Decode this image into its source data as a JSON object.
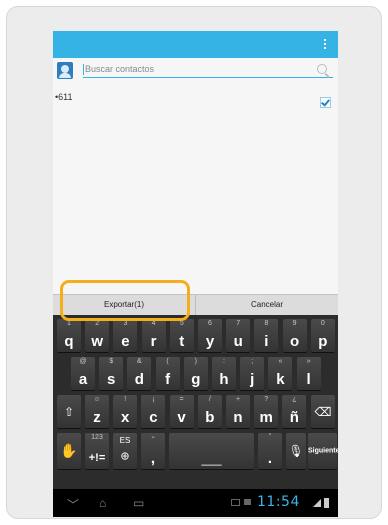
{
  "search": {
    "placeholder": "Buscar contactos"
  },
  "contacts": [
    {
      "name": "•611",
      "checked": true
    }
  ],
  "buttons": {
    "export": "Exportar(1)",
    "cancel": "Cancelar"
  },
  "keyboard": {
    "row1": [
      {
        "main": "q",
        "hint": "1"
      },
      {
        "main": "w",
        "hint": "2"
      },
      {
        "main": "e",
        "hint": "3"
      },
      {
        "main": "r",
        "hint": "4"
      },
      {
        "main": "t",
        "hint": "5"
      },
      {
        "main": "y",
        "hint": "6"
      },
      {
        "main": "u",
        "hint": "7"
      },
      {
        "main": "i",
        "hint": "8"
      },
      {
        "main": "o",
        "hint": "9"
      },
      {
        "main": "p",
        "hint": "0"
      }
    ],
    "row2": [
      {
        "main": "a",
        "hint": "@"
      },
      {
        "main": "s",
        "hint": "$"
      },
      {
        "main": "d",
        "hint": "&"
      },
      {
        "main": "f",
        "hint": "("
      },
      {
        "main": "g",
        "hint": ")"
      },
      {
        "main": "h",
        "hint": ":"
      },
      {
        "main": "j",
        "hint": ";"
      },
      {
        "main": "k",
        "hint": "«"
      },
      {
        "main": "l",
        "hint": "»"
      }
    ],
    "row3": [
      {
        "main": "z",
        "hint": "☺"
      },
      {
        "main": "x",
        "hint": "!"
      },
      {
        "main": "c",
        "hint": "¡"
      },
      {
        "main": "v",
        "hint": "="
      },
      {
        "main": "b",
        "hint": "/"
      },
      {
        "main": "n",
        "hint": "+"
      },
      {
        "main": "m",
        "hint": "?"
      },
      {
        "main": "ñ",
        "hint": "¿"
      }
    ],
    "row4": {
      "symbols_hint": "123",
      "symbols": "+!=",
      "lang": "ES",
      "comma": ",",
      "dash": "-",
      "period": ".",
      "apostrophe": "'",
      "enter": "Siguiente"
    }
  },
  "status": {
    "time": "11:54"
  },
  "icons": {
    "accent": "#34b3e4",
    "highlight": "#f3ae1b"
  }
}
